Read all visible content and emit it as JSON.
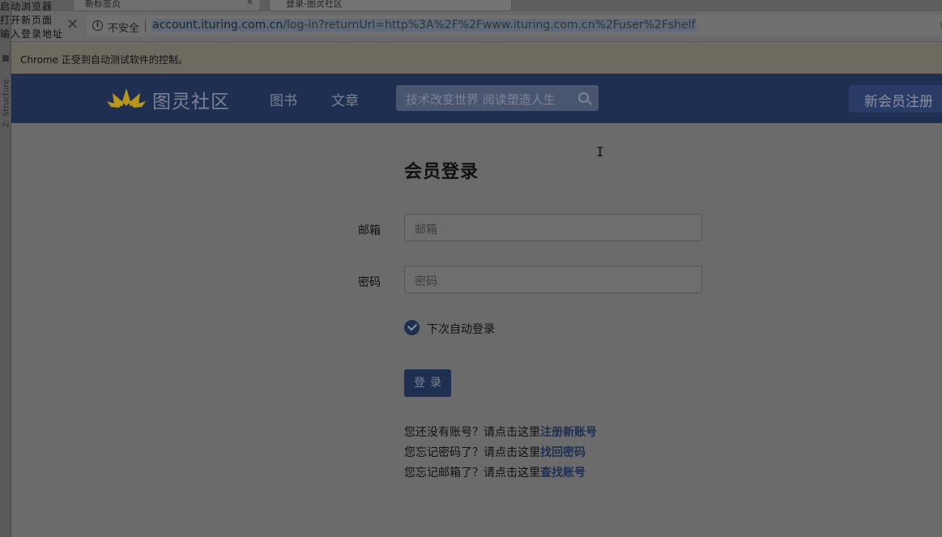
{
  "overlay_log": [
    "启动浏览器",
    "打开新页面",
    "输入登录地址"
  ],
  "ide": {
    "structure_label": "Z: Structure"
  },
  "browser": {
    "tabs": [
      {
        "title": "新标签页"
      },
      {
        "title": "登录-图灵社区"
      }
    ],
    "security_label": "不安全",
    "url_host": "account.ituring.com.cn",
    "url_path": "/log-in?returnUrl=http%3A%2F%2Fwww.ituring.com.cn%2Fuser%2Fshelf",
    "infobar_text": "Chrome 正受到自动测试软件的控制。"
  },
  "site": {
    "logo_text": "图灵社区",
    "nav": [
      "图书",
      "文章"
    ],
    "search_placeholder": "技术改变世界 阅读塑造人生",
    "register_label": "新会员注册"
  },
  "login": {
    "title": "会员登录",
    "email_label": "邮箱",
    "email_placeholder": "邮箱",
    "password_label": "密码",
    "password_placeholder": "密码",
    "remember_checked": true,
    "remember_label": "下次自动登录",
    "submit_label": "登录",
    "help": [
      {
        "text": "您还没有账号？请点击这里",
        "link": "注册新账号"
      },
      {
        "text": "您忘记密码了？请点击这里",
        "link": "找回密码"
      },
      {
        "text": "您忘记邮箱了？请点击这里",
        "link": "查找账号"
      }
    ]
  },
  "colors": {
    "brand_navy": "#1f2f52",
    "logo_gold": "#b8961e"
  }
}
